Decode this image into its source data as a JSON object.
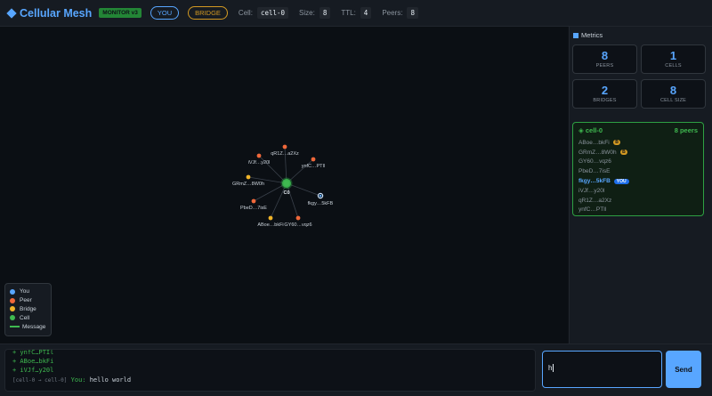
{
  "header": {
    "title": "Cellular Mesh",
    "monitor_badge": "MONITOR v3",
    "you_pill": "YOU",
    "bridge_pill": "BRIDGE",
    "cell_label": "Cell:",
    "cell_value": "cell-0",
    "size_label": "Size:",
    "size_value": "8",
    "ttl_label": "TTL:",
    "ttl_value": "4",
    "peers_label": "Peers:",
    "peers_value": "8"
  },
  "graph": {
    "center_label": "C0",
    "nodes": [
      {
        "label": "qR1Z…a2Xz",
        "type": "peer"
      },
      {
        "label": "ynfC…PTIl",
        "type": "peer"
      },
      {
        "label": "iVJf…y20l",
        "type": "peer"
      },
      {
        "label": "GRmZ…8W0h",
        "type": "bridge"
      },
      {
        "label": "fkgy…5kFB",
        "type": "you"
      },
      {
        "label": "PbeD…7isE",
        "type": "peer"
      },
      {
        "label": "ABoe…bkFi",
        "type": "bridge"
      },
      {
        "label": "GY60…vqz6",
        "type": "peer"
      }
    ]
  },
  "legend": {
    "items": [
      {
        "label": "You",
        "color": "#58a6ff"
      },
      {
        "label": "Peer",
        "color": "#f0683a"
      },
      {
        "label": "Bridge",
        "color": "#f0b429"
      },
      {
        "label": "Cell",
        "color": "#3fb950"
      }
    ],
    "message_label": "Message"
  },
  "sidebar": {
    "title": "Metrics",
    "metrics": [
      {
        "value": "8",
        "label": "PEERS"
      },
      {
        "value": "1",
        "label": "CELLS"
      },
      {
        "value": "2",
        "label": "BRIDGES"
      },
      {
        "value": "8",
        "label": "CELL SIZE"
      }
    ],
    "cell": {
      "name": "cell-0",
      "peer_count": "8 peers",
      "peers": [
        {
          "label": "ABoe…bkFi",
          "badge": "B"
        },
        {
          "label": "GRmZ…8W0h",
          "badge": "B"
        },
        {
          "label": "GY60…vqz6",
          "badge": ""
        },
        {
          "label": "PbeD…7isE",
          "badge": ""
        },
        {
          "label": "fkgy…5kFB",
          "badge": "YOU"
        },
        {
          "label": "iVJf…y20l",
          "badge": ""
        },
        {
          "label": "qR1Z…a2Xz",
          "badge": ""
        },
        {
          "label": "ynfC…PTIl",
          "badge": ""
        }
      ]
    }
  },
  "log": {
    "lines": [
      "+ ynfC…PTIl",
      "+ ABoe…bkFi",
      "+ iVJf…y20l"
    ],
    "message": {
      "route": "[cell-0 → cell-0]",
      "sender": "You:",
      "text": "hello world"
    }
  },
  "composer": {
    "value": "h",
    "send_label": "Send"
  },
  "colors": {
    "you": "#58a6ff",
    "peer": "#f0683a",
    "bridge": "#f0b429",
    "cell": "#3fb950"
  }
}
